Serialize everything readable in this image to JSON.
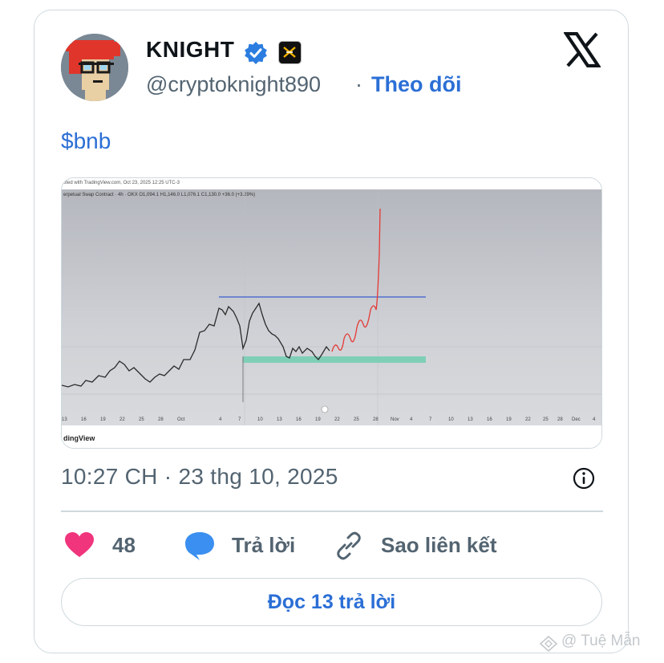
{
  "author": {
    "name": "KNIGHT",
    "handle": "@cryptoknight890",
    "separator": "·",
    "follow_label": "Theo dõi"
  },
  "tweet": {
    "text": "$bnb",
    "timestamp": "10:27 CH · 23 thg 10, 2025"
  },
  "media": {
    "header_text": "oted with TradingView.com, Oct 23, 2025 12:25 UTC-3",
    "symbol_text": "erpetual Swap Contract · 4h · OKX  O1,094.1  H1,146.0  L1,076.1  C1,130.0  +36.0 (+3.29%)",
    "x_ticks": [
      "13",
      "16",
      "19",
      "22",
      "25",
      "28",
      "Oct",
      "4",
      "7",
      "10",
      "13",
      "16",
      "19",
      "22",
      "25",
      "28",
      "Nov",
      "4",
      "7",
      "10",
      "13",
      "16",
      "19",
      "22",
      "25",
      "28",
      "Dec",
      "4"
    ],
    "footer_text": "dingView"
  },
  "actions": {
    "likes_count": "48",
    "reply_label": "Trả lời",
    "copy_link_label": "Sao liên kết",
    "read_replies_label": "Đọc 13 trả lời"
  },
  "watermark": "@ Tuệ Mẫn",
  "colors": {
    "accent": "#2b6fd6",
    "heart": "#f0357d",
    "reply_bubble": "#3a8ff0",
    "resistance_line": "#3a5ccf",
    "support_zone": "#7fcfb7",
    "projection": "#e53935"
  },
  "icons": [
    "verified-badge-icon",
    "affiliate-badge-icon",
    "x-logo-icon",
    "info-icon",
    "heart-icon",
    "reply-bubble-icon",
    "link-icon"
  ]
}
